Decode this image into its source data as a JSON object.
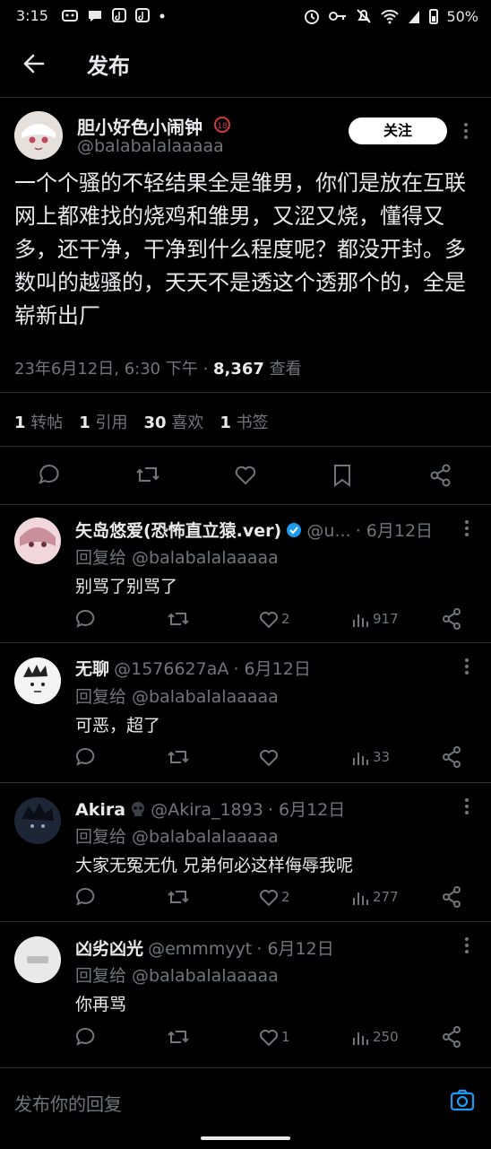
{
  "status": {
    "time": "3:15",
    "battery": "50%"
  },
  "header": {
    "title": "发布"
  },
  "tweet": {
    "author_name": "胆小好色小闹钟",
    "author_handle": "@balabalalaaaaa",
    "follow_label": "关注",
    "text": "一个个骚的不轻结果全是雏男，你们是放在互联网上都难找的烧鸡和雏男，又涩又烧，懂得又多，还干净，干净到什么程度呢？都没开封。多数叫的越骚的，天天不是透这个透那个的，全是崭新出厂",
    "timestamp": "23年6月12日, 6:30 下午 · ",
    "views_count": "8,367",
    "views_label": " 查看",
    "stats": [
      {
        "num": "1",
        "label": "转帖"
      },
      {
        "num": "1",
        "label": "引用"
      },
      {
        "num": "30",
        "label": "喜欢"
      },
      {
        "num": "1",
        "label": "书签"
      }
    ]
  },
  "replies": [
    {
      "name": "矢岛悠爱(恐怖直立猿.ver)",
      "handle": "@u...",
      "date": "· 6月12日",
      "reply_to": "回复给 @balabalalaaaaa",
      "text": "别骂了别骂了",
      "likes": "2",
      "views": "917"
    },
    {
      "name": "无聊",
      "handle": "@1576627aA",
      "date": "· 6月12日",
      "reply_to": "回复给 @balabalalaaaaa",
      "text": "可恶，超了",
      "likes": "",
      "views": "33"
    },
    {
      "name": "Akira",
      "handle": "@Akira_1893",
      "date": "· 6月12日",
      "reply_to": "回复给 @balabalalaaaaa",
      "text": "大家无冤无仇 兄弟何必这样侮辱我呢",
      "likes": "2",
      "views": "277"
    },
    {
      "name": "凶劣凶光",
      "handle": "@emmmyyt",
      "date": "· 6月12日",
      "reply_to": "回复给 @balabalalaaaaa",
      "text": "你再骂",
      "likes": "1",
      "views": "250"
    }
  ],
  "composer": {
    "placeholder": "发布你的回复"
  },
  "colors": {
    "background": "#000000",
    "text": "#e7e9ea",
    "muted": "#71767b",
    "verified": "#1d9bf0",
    "divider": "#2f3336"
  }
}
